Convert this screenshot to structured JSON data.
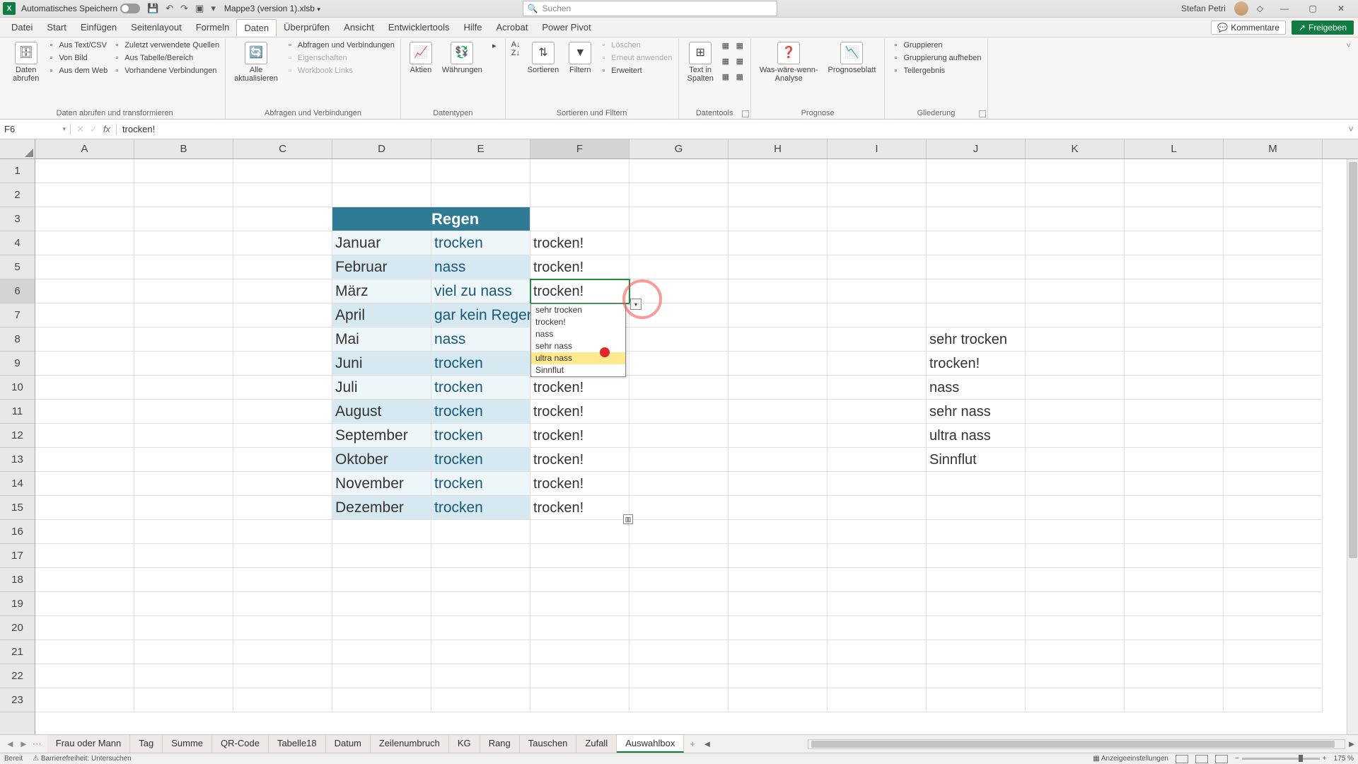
{
  "titlebar": {
    "autosave": "Automatisches Speichern",
    "filename": "Mappe3 (version 1).xlsb",
    "search_placeholder": "Suchen",
    "username": "Stefan Petri"
  },
  "menu": {
    "tabs": [
      "Datei",
      "Start",
      "Einfügen",
      "Seitenlayout",
      "Formeln",
      "Daten",
      "Überprüfen",
      "Ansicht",
      "Entwicklertools",
      "Hilfe",
      "Acrobat",
      "Power Pivot"
    ],
    "active": "Daten",
    "comments": "Kommentare",
    "share": "Freigeben"
  },
  "ribbon": {
    "g1": {
      "name": "Daten abrufen und transformieren",
      "big": "Daten\nabrufen",
      "items": [
        "Aus Text/CSV",
        "Von Bild",
        "Aus dem Web",
        "Zuletzt verwendete Quellen",
        "Aus Tabelle/Bereich",
        "Vorhandene Verbindungen"
      ]
    },
    "g2": {
      "name": "Abfragen und Verbindungen",
      "big": "Alle\naktualisieren",
      "items": [
        "Abfragen und Verbindungen",
        "Eigenschaften",
        "Workbook Links"
      ]
    },
    "g3": {
      "name": "Datentypen",
      "a": "Aktien",
      "b": "Währungen"
    },
    "g4": {
      "name": "Sortieren und Filtern",
      "sort": "Sortieren",
      "filter": "Filtern",
      "items": [
        "Löschen",
        "Erneut anwenden",
        "Erweitert"
      ]
    },
    "g5": {
      "name": "Datentools",
      "big": "Text in\nSpalten"
    },
    "g6": {
      "name": "Prognose",
      "a": "Was-wäre-wenn-\nAnalyse",
      "b": "Prognoseblatt"
    },
    "g7": {
      "name": "Gliederung",
      "items": [
        "Gruppieren",
        "Gruppierung aufheben",
        "Teilergebnis"
      ]
    }
  },
  "formula": {
    "cell": "F6",
    "value": "trocken!"
  },
  "cols": [
    "A",
    "B",
    "C",
    "D",
    "E",
    "F",
    "G",
    "H",
    "I",
    "J",
    "K",
    "L",
    "M"
  ],
  "rows": [
    "1",
    "2",
    "3",
    "4",
    "5",
    "6",
    "7",
    "8",
    "9",
    "10",
    "11",
    "12",
    "13",
    "14",
    "15",
    "16",
    "17",
    "18",
    "19",
    "20",
    "21",
    "22",
    "23"
  ],
  "selColIndex": 5,
  "selRowIndex": 5,
  "table": {
    "header": "Regen",
    "rows": [
      {
        "m": "Januar",
        "v": "trocken",
        "f": "trocken!"
      },
      {
        "m": "Februar",
        "v": "nass",
        "f": "trocken!"
      },
      {
        "m": "März",
        "v": "viel zu nass",
        "f": "trocken!"
      },
      {
        "m": "April",
        "v": "gar kein Regen",
        "f": ""
      },
      {
        "m": "Mai",
        "v": "nass",
        "f": ""
      },
      {
        "m": "Juni",
        "v": "trocken",
        "f": ""
      },
      {
        "m": "Juli",
        "v": "trocken",
        "f": "trocken!"
      },
      {
        "m": "August",
        "v": "trocken",
        "f": "trocken!"
      },
      {
        "m": "September",
        "v": "trocken",
        "f": "trocken!"
      },
      {
        "m": "Oktober",
        "v": "trocken",
        "f": "trocken!"
      },
      {
        "m": "November",
        "v": "trocken",
        "f": "trocken!"
      },
      {
        "m": "Dezember",
        "v": "trocken",
        "f": "trocken!"
      }
    ]
  },
  "dropdown": {
    "items": [
      "sehr trocken",
      "trocken!",
      "nass",
      "sehr nass",
      "ultra nass",
      "Sinnflut"
    ],
    "highlight": 4
  },
  "sidelist": [
    "sehr trocken",
    "trocken!",
    "nass",
    "sehr nass",
    "ultra nass",
    "Sinnflut"
  ],
  "sheets": {
    "tabs": [
      "Frau oder Mann",
      "Tag",
      "Summe",
      "QR-Code",
      "Tabelle18",
      "Datum",
      "Zeilenumbruch",
      "KG",
      "Rang",
      "Tauschen",
      "Zufall",
      "Auswahlbox"
    ],
    "active": "Auswahlbox"
  },
  "status": {
    "ready": "Bereit",
    "acc": "Barrierefreiheit: Untersuchen",
    "disp": "Anzeigeeinstellungen",
    "zoom": "175 %"
  }
}
